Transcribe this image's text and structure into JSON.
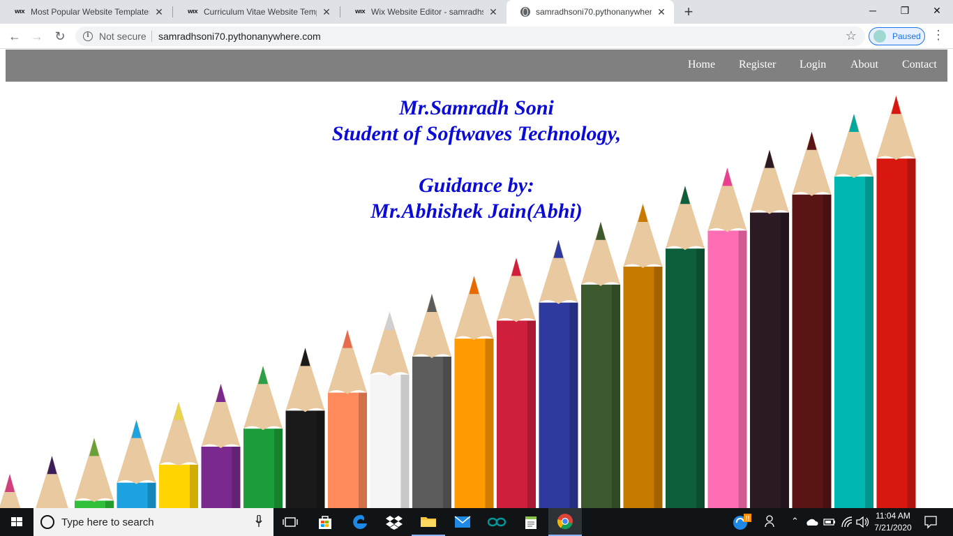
{
  "browser": {
    "tabs": [
      {
        "favicon": "WIX",
        "title": "Most Popular Website Templates",
        "active": false
      },
      {
        "favicon": "WIX",
        "title": "Curriculum Vitae Website Templa",
        "active": false
      },
      {
        "favicon": "WIX",
        "title": "Wix Website Editor - samradhsoni",
        "active": false
      },
      {
        "favicon": "globe-icon",
        "title": "samradhsoni70.pythonanywhere",
        "active": true
      }
    ],
    "security_label": "Not secure",
    "url": "samradhsoni70.pythonanywhere.com",
    "profile_label": "Paused"
  },
  "site": {
    "nav": [
      "Home",
      "Register",
      "Login",
      "About",
      "Contact"
    ],
    "name_line": "Mr.Samradh Soni",
    "role_line": "Student of Softwaves Technology,",
    "guidance_line": "Guidance by:",
    "mentor_line": "Mr.Abhishek Jain(Abhi)"
  },
  "taskbar": {
    "search_placeholder": "Type here to search",
    "time": "11:04 AM",
    "date": "7/21/2020"
  }
}
